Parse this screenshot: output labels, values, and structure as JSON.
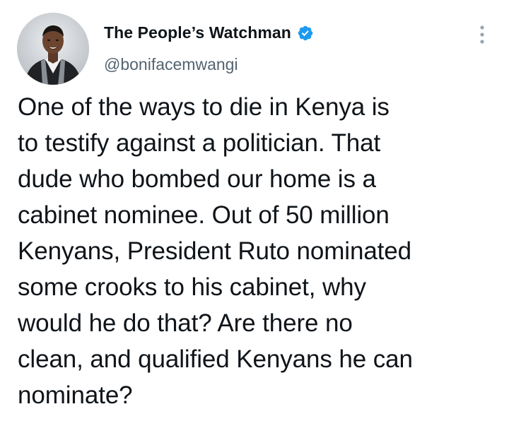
{
  "author": {
    "display_name": "The People’s Watchman",
    "handle": "@bonifacemwangi",
    "verified": true,
    "avatar_icon": "profile-photo",
    "verified_icon": "verified-badge-icon"
  },
  "menu": {
    "more_icon": "more-options-icon"
  },
  "tweet": {
    "lines": [
      "One of the ways to die in Kenya is",
      "to testify against a politician. That",
      "dude who bombed our home is a",
      "cabinet nominee. Out of 50 million",
      "Kenyans, President Ruto nominated",
      "some crooks to his cabinet, why",
      "would he do that? Are there no",
      "clean, and qualified Kenyans he can",
      "nominate?"
    ]
  },
  "colors": {
    "primary_text": "#0f1419",
    "secondary_text": "#536471",
    "verified_blue": "#1d9bf0",
    "background": "#ffffff"
  }
}
